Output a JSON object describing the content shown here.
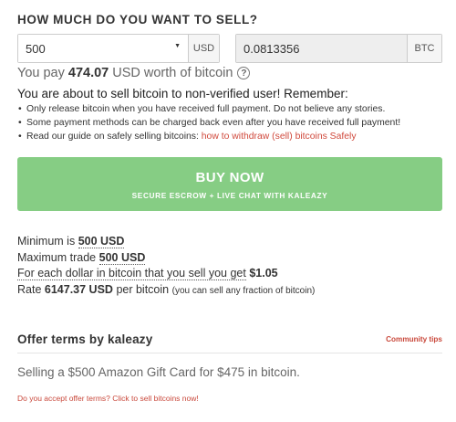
{
  "heading": "HOW MUCH DO YOU WANT TO SELL?",
  "amount": {
    "value": "500",
    "currency": "USD"
  },
  "btc": {
    "value": "0.0813356",
    "currency": "BTC"
  },
  "you_pay": {
    "prefix": "You pay",
    "amount": "474.07",
    "suffix": "USD worth of bitcoin"
  },
  "warning": {
    "title": "You are about to sell bitcoin to non-verified user! Remember:",
    "items": [
      "Only release bitcoin when you have received full payment. Do not believe any stories.",
      "Some payment methods can be charged back even after you have received full payment!"
    ],
    "guide_prefix": "Read our guide on safely selling bitcoins:",
    "guide_link": "how to withdraw (sell) bitcoins Safely"
  },
  "buy_button": {
    "label": "BUY NOW",
    "sublabel": "SECURE ESCROW + LIVE CHAT WITH KALEAZY"
  },
  "limits": {
    "minimum_label": "Minimum is",
    "minimum_value": "500 USD",
    "maximum_label": "Maximum trade",
    "maximum_value": "500 USD",
    "per_dollar_label": "For each dollar in bitcoin that you sell you get",
    "per_dollar_value": "$1.05",
    "rate_label": "Rate",
    "rate_value": "6147.37 USD",
    "rate_suffix": "per bitcoin",
    "rate_note": "(you can sell any fraction of bitcoin)"
  },
  "offer": {
    "title": "Offer terms by kaleazy",
    "community_link": "Community tips",
    "text": "Selling a $500 Amazon Gift Card for $475 in bitcoin.",
    "accept_link": "Do you accept offer terms? Click to sell bitcoins now!"
  },
  "colors": {
    "buy_button": "#86cd84",
    "link": "#c9483b"
  },
  "icons": {
    "help": "question-circle-icon",
    "dropdown": "caret-down-icon"
  }
}
